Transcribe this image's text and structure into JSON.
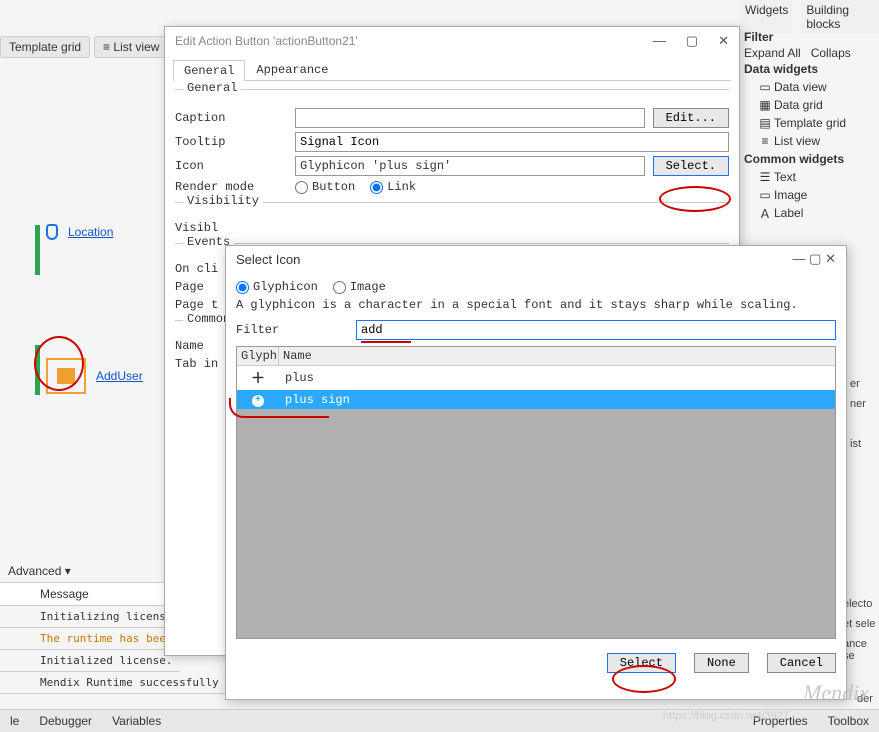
{
  "bgTabs": {
    "widgets": "Widgets",
    "blocks": "Building blocks"
  },
  "bgToolbar": {
    "templateGrid": "Template grid",
    "listView": "List view"
  },
  "rightPanel": {
    "filter": "Filter",
    "expandAll": "Expand All",
    "collapse": "Collaps",
    "dataWidgetsHdr": "Data widgets",
    "items": [
      {
        "label": "Data view"
      },
      {
        "label": "Data grid"
      },
      {
        "label": "Template grid"
      },
      {
        "label": "List view"
      }
    ],
    "commonHdr": "Common widgets",
    "common": [
      {
        "label": "Text"
      },
      {
        "label": "Image"
      },
      {
        "label": "Label"
      }
    ]
  },
  "rightEdgeWords": [
    "er",
    "ner",
    "ist",
    "electo",
    "et sele",
    "ance se",
    "der"
  ],
  "canvas": {
    "location": "Location",
    "addUser": "AddUser"
  },
  "bottomPanel": {
    "advanced": "Advanced  ▾",
    "msgHeader": "Message",
    "rows": [
      "Initializing licens",
      "The runtime has bee",
      "Initialized license.",
      "Mendix Runtime successfully s"
    ]
  },
  "bottomTabs": {
    "left": [
      "le",
      "Debugger",
      "Variables"
    ],
    "right": [
      "Properties",
      "Toolbox"
    ]
  },
  "dialog1": {
    "title": "Edit Action Button 'actionButton21'",
    "tabs": {
      "general": "General",
      "appearance": "Appearance"
    },
    "sections": {
      "general": "General",
      "visibility": "Visibility",
      "events": "Events",
      "common": "Common"
    },
    "form": {
      "captionLbl": "Caption",
      "captionVal": "",
      "editBtn": "Edit...",
      "tooltipLbl": "Tooltip",
      "tooltipVal": "Signal Icon",
      "iconLbl": "Icon",
      "iconVal": "Glyphicon 'plus sign'",
      "selectBtn": "Select.",
      "renderLbl": "Render mode",
      "renderOpts": [
        "Button",
        "Link"
      ],
      "visibleLbl": "Visibl",
      "onclickLbl": "On cli",
      "pageLbl": "Page",
      "pagetLbl": "Page t",
      "nameLbl": "Name",
      "tabinLbl": "Tab in"
    }
  },
  "dialog2": {
    "title": "Select Icon",
    "radios": [
      "Glyphicon",
      "Image"
    ],
    "infoText": "A glyphicon is a character in a special font and it stays sharp while scaling.",
    "filterLbl": "Filter",
    "filterVal": "add",
    "cols": {
      "glyph": "Glyph",
      "name": "Name"
    },
    "rows": [
      {
        "name": "plus"
      },
      {
        "name": "plus sign"
      }
    ],
    "buttons": {
      "select": "Select",
      "none": "None",
      "cancel": "Cancel"
    }
  },
  "watermark": "Mendix",
  "watermarkUrl": "https://blog.csdn.net/3927"
}
